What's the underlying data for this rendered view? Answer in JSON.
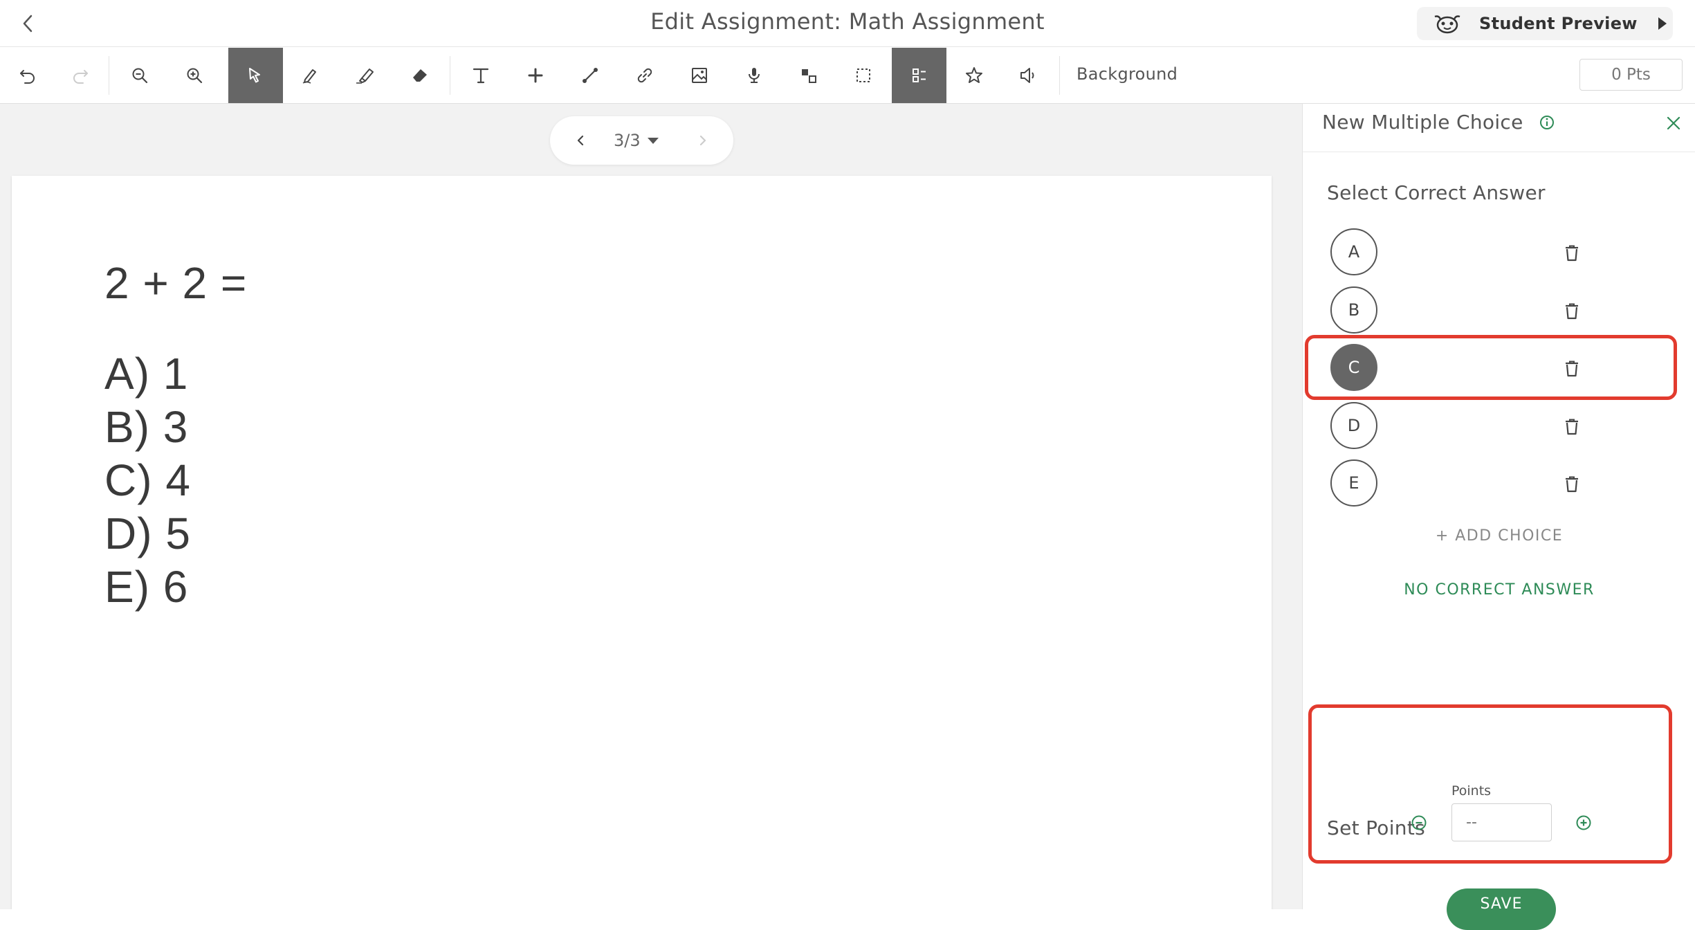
{
  "header": {
    "title": "Edit Assignment: Math Assignment",
    "preview_label": "Student Preview"
  },
  "toolbar": {
    "tools": [
      {
        "name": "undo-icon",
        "active": false
      },
      {
        "name": "redo-icon",
        "active": false
      },
      {
        "name": "zoom-out-icon",
        "active": false
      },
      {
        "name": "zoom-in-icon",
        "active": false
      },
      {
        "name": "select-pointer-icon",
        "active": true
      },
      {
        "name": "pen-icon",
        "active": false
      },
      {
        "name": "highlighter-icon",
        "active": false
      },
      {
        "name": "eraser-icon",
        "active": false
      },
      {
        "name": "text-icon",
        "active": false
      },
      {
        "name": "plus-icon",
        "active": false
      },
      {
        "name": "line-icon",
        "active": false
      },
      {
        "name": "link-icon",
        "active": false
      },
      {
        "name": "image-icon",
        "active": false
      },
      {
        "name": "microphone-icon",
        "active": false
      },
      {
        "name": "shapes-icon",
        "active": false
      },
      {
        "name": "marquee-select-icon",
        "active": false
      },
      {
        "name": "multiple-choice-icon",
        "active": true
      },
      {
        "name": "star-icon",
        "active": false
      },
      {
        "name": "speaker-icon",
        "active": false
      }
    ],
    "background_label": "Background",
    "points_label": "0 Pts"
  },
  "pager": {
    "page_text": "3/3"
  },
  "sheet": {
    "question": "2 + 2 =",
    "choices": [
      "A) 1",
      "B) 3",
      "C) 4",
      "D) 5",
      "E) 6"
    ]
  },
  "panel": {
    "title": "New Multiple Choice",
    "section_title": "Select Correct Answer",
    "choices": [
      {
        "letter": "A",
        "selected": false
      },
      {
        "letter": "B",
        "selected": false
      },
      {
        "letter": "C",
        "selected": true
      },
      {
        "letter": "D",
        "selected": false
      },
      {
        "letter": "E",
        "selected": false
      }
    ],
    "add_choice_label": "+ ADD CHOICE",
    "no_correct_label": "NO CORRECT ANSWER",
    "points_section_title": "Set Points",
    "points_field_label": "Points",
    "points_placeholder": "--",
    "save_label": "SAVE"
  },
  "colors": {
    "accent_green": "#3a8f5a",
    "highlight_red": "#e23b2e",
    "active_tool_gray": "#666666"
  }
}
